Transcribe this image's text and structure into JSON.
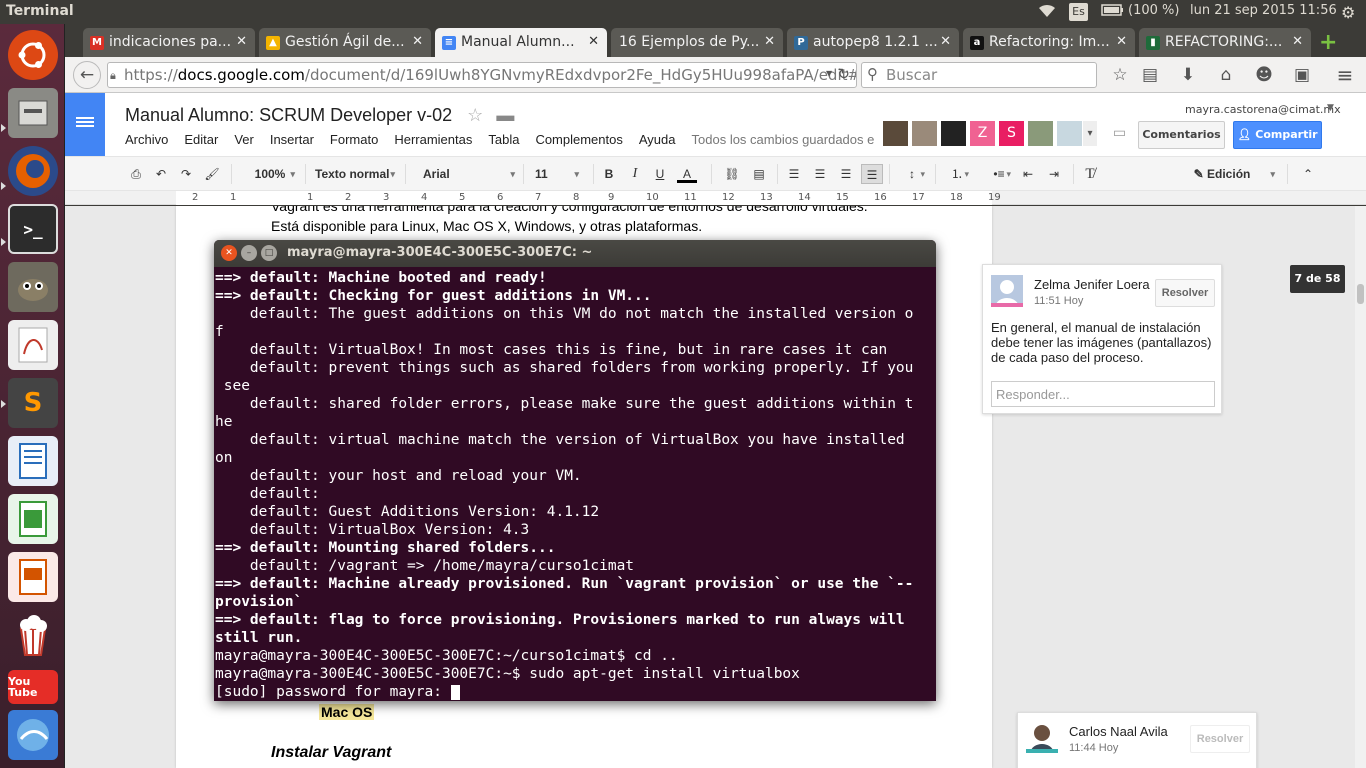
{
  "panel": {
    "app_title": "Terminal",
    "lang": "Es",
    "battery": "(100 %)",
    "datetime": "lun 21 sep 2015 11:56"
  },
  "launcher": [
    "ubuntu-dash",
    "files",
    "firefox",
    "terminal",
    "gimp",
    "evince",
    "sublime-text",
    "libreoffice-writer",
    "libreoffice-calc",
    "libreoffice-impress",
    "popcorn-time",
    "youtube",
    "mysql-workbench"
  ],
  "launcher_youtube_label": "You Tube",
  "tabs": [
    {
      "title": "indicaciones pa...",
      "icon": "gmail-icon",
      "color": "#d93025",
      "active": false
    },
    {
      "title": "Gestión Ágil de...",
      "icon": "drive-icon",
      "color": "#f4b400",
      "active": false
    },
    {
      "title": "Manual Alumn...",
      "icon": "docs-icon",
      "color": "#4285f4",
      "active": true
    },
    {
      "title": "16 Ejemplos de Py...",
      "icon": "blank-icon",
      "color": "#5b5a55",
      "active": false
    },
    {
      "title": "autopep8 1.2.1 ...",
      "icon": "python-icon",
      "color": "#306998",
      "active": false
    },
    {
      "title": "Refactoring: Im...",
      "icon": "amazon-icon",
      "color": "#111111",
      "active": false
    },
    {
      "title": "REFACTORING:...",
      "icon": "book-icon",
      "color": "#1e6b3a",
      "active": false
    }
  ],
  "nav": {
    "url_prefix": "https://",
    "url_domain": "docs.google.com",
    "url_rest": "/document/d/169lUwh8YGNvmyREdxdvpor2Fe_HdGy5HUu998afaPA/edit#",
    "search_placeholder": "Buscar"
  },
  "docs": {
    "title": "Manual Alumno: SCRUM Developer v-02",
    "menus": [
      "Archivo",
      "Editar",
      "Ver",
      "Insertar",
      "Formato",
      "Herramientas",
      "Tabla",
      "Complementos",
      "Ayuda"
    ],
    "saved_status": "Todos los cambios guardados e",
    "user_email": "mayra.castorena@cimat.mx",
    "comments_btn": "Comentarios",
    "share_btn": "Compartir",
    "collab_letters": [
      "Z",
      "S"
    ]
  },
  "toolbar": {
    "zoom": "100%",
    "style": "Texto normal",
    "font": "Arial",
    "size": "11",
    "mode": "Edición"
  },
  "ruler": [
    "2",
    "1",
    "1",
    "2",
    "3",
    "4",
    "5",
    "6",
    "7",
    "8",
    "9",
    "10",
    "11",
    "12",
    "13",
    "14",
    "15",
    "16",
    "17",
    "18",
    "19"
  ],
  "page": {
    "line1": "Vagrant es una herramienta para la creación y configuración de entornos de desarrollo virtuales.",
    "line2": "Está disponible para Linux, Mac OS X, Windows, y otras plataformas.",
    "macos": "Mac OS",
    "heading": "Instalar Vagrant"
  },
  "page_count": "7 de 58",
  "comments": [
    {
      "author": "Zelma Jenifer Loera",
      "time": "11:51 Hoy",
      "resolve": "Resolver",
      "body": "En general, el manual de instalación debe tener las imágenes (pantallazos) de cada paso del proceso.",
      "reply_placeholder": "Responder..."
    },
    {
      "author": "Carlos Naal Avila",
      "time": "11:44 Hoy",
      "resolve": "Resolver"
    }
  ],
  "terminal": {
    "title": "mayra@mayra-300E4C-300E5C-300E7C: ~",
    "lines": [
      {
        "text": "==> default: Machine booted and ready!",
        "bold": true
      },
      {
        "text": "==> default: Checking for guest additions in VM...",
        "bold": true
      },
      {
        "text": "    default: The guest additions on this VM do not match the installed version o",
        "bold": false
      },
      {
        "text": "f",
        "bold": false
      },
      {
        "text": "    default: VirtualBox! In most cases this is fine, but in rare cases it can",
        "bold": false
      },
      {
        "text": "    default: prevent things such as shared folders from working properly. If you",
        "bold": false
      },
      {
        "text": " see",
        "bold": false
      },
      {
        "text": "    default: shared folder errors, please make sure the guest additions within t",
        "bold": false
      },
      {
        "text": "he",
        "bold": false
      },
      {
        "text": "    default: virtual machine match the version of VirtualBox you have installed",
        "bold": false
      },
      {
        "text": "on",
        "bold": false
      },
      {
        "text": "    default: your host and reload your VM.",
        "bold": false
      },
      {
        "text": "    default:",
        "bold": false
      },
      {
        "text": "    default: Guest Additions Version: 4.1.12",
        "bold": false
      },
      {
        "text": "    default: VirtualBox Version: 4.3",
        "bold": false
      },
      {
        "text": "==> default: Mounting shared folders...",
        "bold": true
      },
      {
        "text": "    default: /vagrant => /home/mayra/curso1cimat",
        "bold": false
      },
      {
        "text": "==> default: Machine already provisioned. Run `vagrant provision` or use the `--",
        "bold": true
      },
      {
        "text": "provision`",
        "bold": true
      },
      {
        "text": "==> default: flag to force provisioning. Provisioners marked to run always will",
        "bold": true
      },
      {
        "text": "still run.",
        "bold": true
      },
      {
        "text": "mayra@mayra-300E4C-300E5C-300E7C:~/curso1cimat$ cd ..",
        "bold": false
      },
      {
        "text": "mayra@mayra-300E4C-300E5C-300E7C:~$ sudo apt-get install virtualbox",
        "bold": false
      },
      {
        "text": "[sudo] password for mayra: ",
        "bold": false,
        "cursor": true
      }
    ]
  }
}
